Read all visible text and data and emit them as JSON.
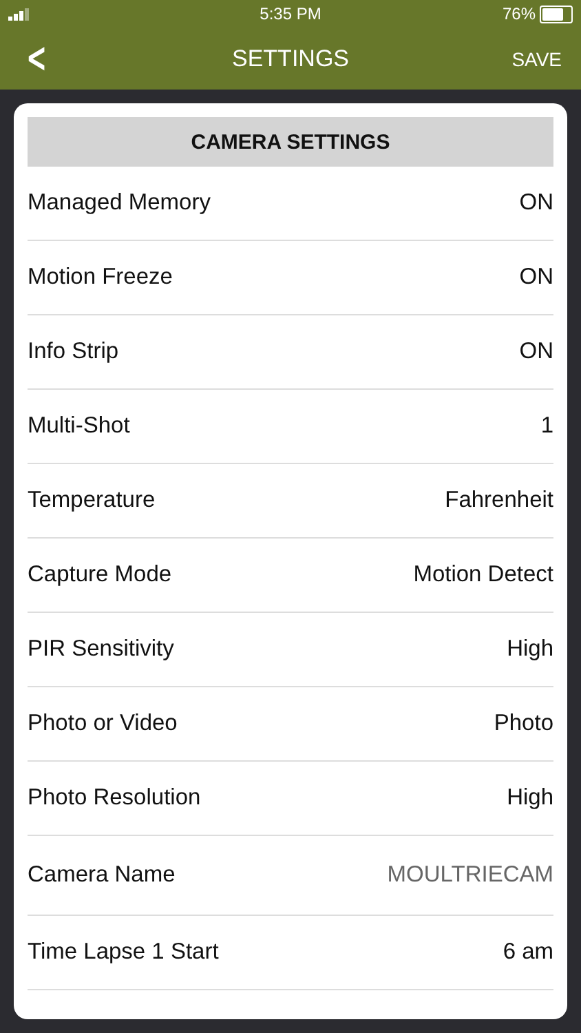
{
  "status_bar": {
    "time": "5:35 PM",
    "battery": "76%"
  },
  "nav": {
    "title": "SETTINGS",
    "back": "<",
    "action": "SAVE"
  },
  "section": {
    "title": "CAMERA SETTINGS"
  },
  "settings": [
    {
      "label": "Managed Memory",
      "value": "ON",
      "kind": "select"
    },
    {
      "label": "Motion Freeze",
      "value": "ON",
      "kind": "select"
    },
    {
      "label": "Info Strip",
      "value": "ON",
      "kind": "select"
    },
    {
      "label": "Multi-Shot",
      "value": "1",
      "kind": "select"
    },
    {
      "label": "Temperature",
      "value": "Fahrenheit",
      "kind": "select"
    },
    {
      "label": "Capture Mode",
      "value": "Motion Detect",
      "kind": "select"
    },
    {
      "label": "PIR Sensitivity",
      "value": "High",
      "kind": "select"
    },
    {
      "label": "Photo or Video",
      "value": "Photo",
      "kind": "select"
    },
    {
      "label": "Photo Resolution",
      "value": "High",
      "kind": "select"
    },
    {
      "label": "Camera Name",
      "value": "MOULTRIECAM",
      "kind": "field"
    },
    {
      "label": "Time Lapse 1 Start",
      "value": "6 am",
      "kind": "select"
    }
  ]
}
